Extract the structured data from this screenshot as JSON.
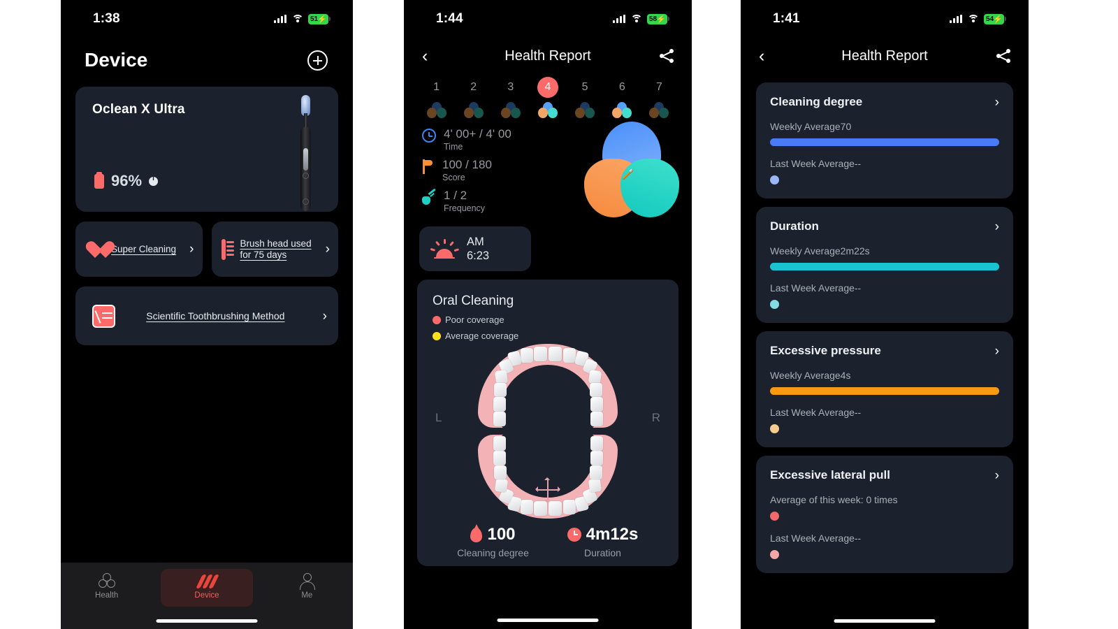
{
  "phone1": {
    "status": {
      "time": "1:38",
      "battery": "51",
      "battery_pct": 51
    },
    "title": "Device",
    "add_icon": "plus-icon",
    "device": {
      "name": "Oclean X Ultra",
      "battery": "96%"
    },
    "tiles": [
      {
        "label": "Super Cleaning",
        "icon": "heart-icon"
      },
      {
        "label": "Brush head used for 75 days",
        "icon": "brush-head-icon"
      }
    ],
    "wide_tile": {
      "label": "Scientific Toothbrushing Method",
      "icon": "book-pen-icon"
    },
    "tabs": [
      {
        "label": "Health",
        "icon": "trefoil-icon",
        "active": false
      },
      {
        "label": "Device",
        "icon": "device-stripes-icon",
        "active": true
      },
      {
        "label": "Me",
        "icon": "person-icon",
        "active": false
      }
    ]
  },
  "phone2": {
    "status": {
      "time": "1:44",
      "battery": "58",
      "battery_pct": 58
    },
    "nav": {
      "title": "Health Report",
      "back_icon": "chevron-left-icon",
      "share_icon": "share-icon"
    },
    "days": [
      {
        "n": "1",
        "selected": false,
        "active": false
      },
      {
        "n": "2",
        "selected": false,
        "active": false
      },
      {
        "n": "3",
        "selected": false,
        "active": false
      },
      {
        "n": "4",
        "selected": true,
        "active": true
      },
      {
        "n": "5",
        "selected": false,
        "active": false
      },
      {
        "n": "6",
        "selected": false,
        "active": true
      },
      {
        "n": "7",
        "selected": false,
        "active": false
      }
    ],
    "stats": [
      {
        "value": "4' 00+",
        "sep": " / 4' 00",
        "key": "Time",
        "icon": "clock-icon",
        "color": "#3a86f5"
      },
      {
        "value": "100",
        "sep": " / 180",
        "key": "Score",
        "icon": "flag-icon",
        "color": "#f79133"
      },
      {
        "value": "1",
        "sep": " / 2",
        "key": "Frequency",
        "icon": "frequency-icon",
        "color": "#1fd0c3"
      }
    ],
    "session": {
      "meridiem": "AM",
      "time": "6:23",
      "icon": "sunrise-icon"
    },
    "oral": {
      "title": "Oral Cleaning",
      "legend": [
        {
          "label": "Poor coverage",
          "color": "#fc6a6a"
        },
        {
          "label": "Average coverage",
          "color": "#ffe01b"
        }
      ],
      "left_label": "L",
      "right_label": "R"
    },
    "bottom_stats": [
      {
        "value": "100",
        "caption": "Cleaning degree",
        "icon": "drop-icon"
      },
      {
        "value": "4m12s",
        "caption": "Duration",
        "icon": "clock-filled-icon"
      }
    ]
  },
  "phone3": {
    "status": {
      "time": "1:41",
      "battery": "54",
      "battery_pct": 54
    },
    "nav": {
      "title": "Health Report",
      "back_icon": "chevron-left-icon",
      "share_icon": "share-icon"
    },
    "cards": [
      {
        "title": "Cleaning degree",
        "this_week": "Weekly Average70",
        "last_week": "Last Week Average--",
        "bar_color": "#4a7bf7",
        "dot_color": "#9cb6f7",
        "bar_width": "100%",
        "has_bar": true
      },
      {
        "title": "Duration",
        "this_week": "Weekly Average2m22s",
        "last_week": "Last Week Average--",
        "bar_color": "#17c4d0",
        "dot_color": "#84dde4",
        "bar_width": "100%",
        "has_bar": true
      },
      {
        "title": "Excessive pressure",
        "this_week": "Weekly Average4s",
        "last_week": "Last Week Average--",
        "bar_color": "#f79a12",
        "dot_color": "#f6cd8f",
        "bar_width": "100%",
        "has_bar": true
      },
      {
        "title": "Excessive lateral pull",
        "this_week": "Average of this week: 0  times",
        "last_week": "Last Week Average--",
        "bar_color": "#f2696c",
        "dot_color": "#f5a6a8",
        "bar_width": "0%",
        "has_bar": false
      }
    ]
  },
  "colors": {
    "page_bg": "#ffffff",
    "phone_bg": "#000000",
    "card_bg": "#1b222e",
    "accent_red": "#fc6a6a",
    "blue": "#4a7bf7",
    "teal": "#17c4d0",
    "orange": "#f79a12"
  }
}
